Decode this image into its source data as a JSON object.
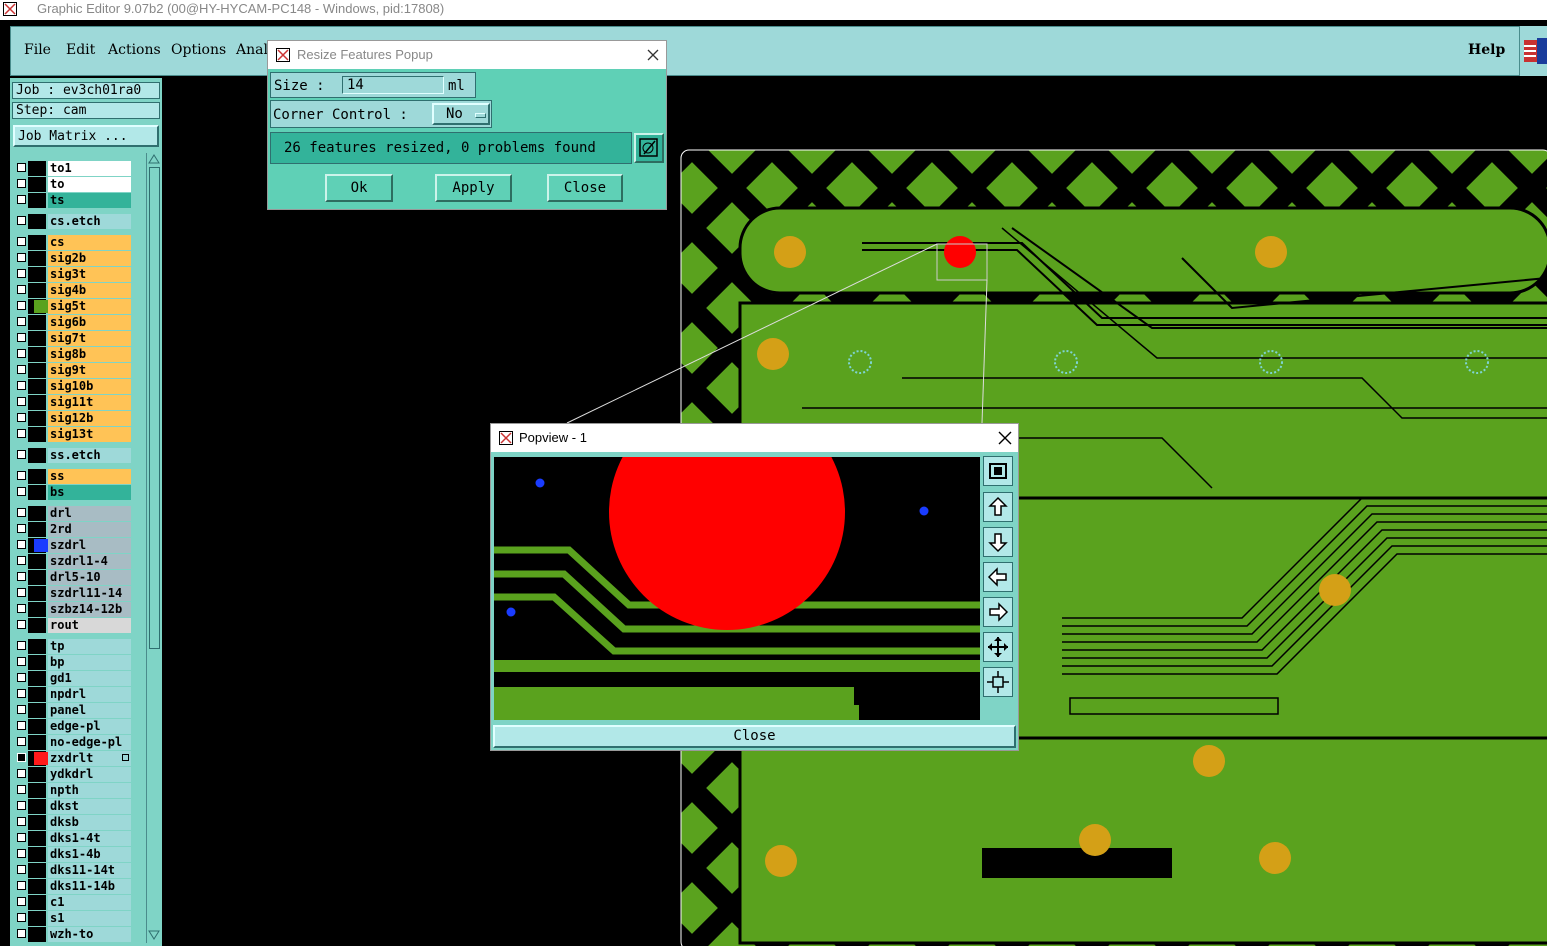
{
  "window": {
    "title": "Graphic Editor 9.07b2 (00@HY-HYCAM-PC148 - Windows, pid:17808)"
  },
  "menu": {
    "file": "File",
    "edit": "Edit",
    "actions": "Actions",
    "options": "Options",
    "analysis_partial": "Analy",
    "help": "Help"
  },
  "job": {
    "job_line": "Job : ev3ch01ra0",
    "step_line": "Step: cam",
    "matrix_button": "Job Matrix ..."
  },
  "layers": [
    {
      "name": "to1",
      "bg": "#ffffff"
    },
    {
      "name": "to",
      "bg": "#ffffff"
    },
    {
      "name": "ts",
      "bg": "#33b39a"
    },
    {
      "name": "cs.etch",
      "bg": "#9ed9d9"
    },
    {
      "name": "cs",
      "bg": "#ffc356"
    },
    {
      "name": "sig2b",
      "bg": "#ffc356"
    },
    {
      "name": "sig3t",
      "bg": "#ffc356"
    },
    {
      "name": "sig4b",
      "bg": "#ffc356"
    },
    {
      "name": "sig5t",
      "bg": "#ffc356",
      "color": "#5aa21e"
    },
    {
      "name": "sig6b",
      "bg": "#ffc356"
    },
    {
      "name": "sig7t",
      "bg": "#ffc356"
    },
    {
      "name": "sig8b",
      "bg": "#ffc356"
    },
    {
      "name": "sig9t",
      "bg": "#ffc356"
    },
    {
      "name": "sig10b",
      "bg": "#ffc356"
    },
    {
      "name": "sig11t",
      "bg": "#ffc356"
    },
    {
      "name": "sig12b",
      "bg": "#ffc356"
    },
    {
      "name": "sig13t",
      "bg": "#ffc356"
    },
    {
      "name": "ss.etch",
      "bg": "#9ed9d9"
    },
    {
      "name": "ss",
      "bg": "#ffc356"
    },
    {
      "name": "bs",
      "bg": "#33b39a"
    },
    {
      "name": "drl",
      "bg": "#a8bcc4"
    },
    {
      "name": "2rd",
      "bg": "#a8bcc4"
    },
    {
      "name": "szdrl",
      "bg": "#a8bcc4",
      "color": "#1a3cff"
    },
    {
      "name": "szdrl1-4",
      "bg": "#a8bcc4"
    },
    {
      "name": "drl5-10",
      "bg": "#a8bcc4"
    },
    {
      "name": "szdrl11-14",
      "bg": "#a8bcc4"
    },
    {
      "name": "szbz14-12b",
      "bg": "#a8bcc4"
    },
    {
      "name": "rout",
      "bg": "#d8d8d8"
    },
    {
      "name": "tp",
      "bg": "#9ed9d9"
    },
    {
      "name": "bp",
      "bg": "#9ed9d9"
    },
    {
      "name": "gd1",
      "bg": "#9ed9d9"
    },
    {
      "name": "npdrl",
      "bg": "#9ed9d9"
    },
    {
      "name": "panel",
      "bg": "#9ed9d9"
    },
    {
      "name": "edge-pl",
      "bg": "#9ed9d9"
    },
    {
      "name": "no-edge-pl",
      "bg": "#9ed9d9"
    },
    {
      "name": "zxdrlt",
      "bg": "#9ed9d9",
      "color": "#ff1a1a",
      "checked": true
    },
    {
      "name": "ydkdrl",
      "bg": "#9ed9d9"
    },
    {
      "name": "npth",
      "bg": "#9ed9d9"
    },
    {
      "name": "dkst",
      "bg": "#9ed9d9"
    },
    {
      "name": "dksb",
      "bg": "#9ed9d9"
    },
    {
      "name": "dks1-4t",
      "bg": "#9ed9d9"
    },
    {
      "name": "dks1-4b",
      "bg": "#9ed9d9"
    },
    {
      "name": "dks11-14t",
      "bg": "#9ed9d9"
    },
    {
      "name": "dks11-14b",
      "bg": "#9ed9d9"
    },
    {
      "name": "c1",
      "bg": "#9ed9d9"
    },
    {
      "name": "s1",
      "bg": "#9ed9d9"
    },
    {
      "name": "wzh-to",
      "bg": "#9ed9d9"
    }
  ],
  "resize_popup": {
    "title": "Resize Features Popup",
    "size_label": "Size :",
    "size_value": "14",
    "size_unit": "ml",
    "corner_label": "Corner Control :",
    "corner_value": "No",
    "status": "26 features resized, 0 problems found",
    "ok": "Ok",
    "apply": "Apply",
    "close": "Close"
  },
  "popview": {
    "title": "Popview - 1",
    "close": "Close"
  },
  "colors": {
    "board_green": "#5aa21e",
    "pad_yellow": "#d4a017",
    "flash_red": "#ff0000",
    "ui_teal": "#9ed9d9",
    "dialog_teal": "#5fd0b6"
  }
}
